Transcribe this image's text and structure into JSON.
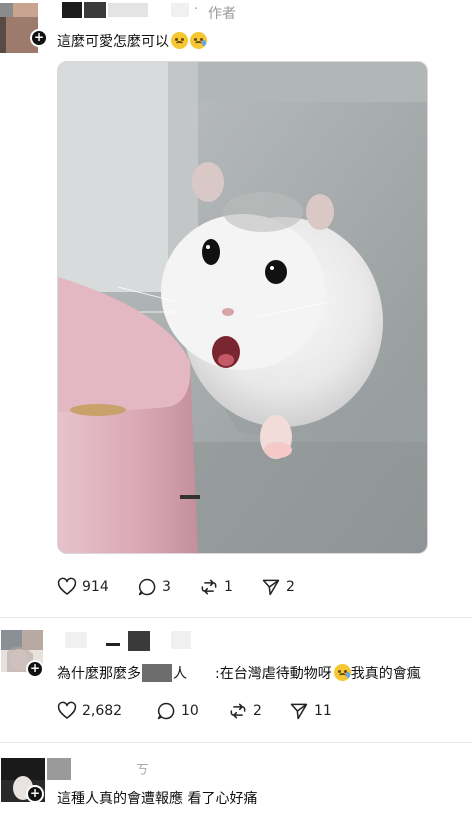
{
  "post": {
    "author_tag": "作者",
    "text": "這麼可愛怎麼可以",
    "emojis": [
      "sad-face-emoji",
      "crying-face-emoji"
    ],
    "actions": {
      "likes": "914",
      "replies": "3",
      "reposts": "1",
      "shares": "2"
    }
  },
  "reply1": {
    "text_before": "為什麼那麼多",
    "text_middle": "人",
    "text_after": ":在台灣虐待動物呀",
    "text_end": "我真的會瘋",
    "actions": {
      "likes": "2,682",
      "replies": "10",
      "reposts": "2",
      "shares": "11"
    }
  },
  "reply2": {
    "name_fragment": "ㄎ",
    "text": "這種人真的會遭報應 看了心好痛"
  },
  "icons": {
    "like": "heart-icon",
    "reply": "comment-bubble-icon",
    "repost": "repost-icon",
    "share": "send-icon",
    "follow": "plus-icon"
  },
  "colors": {
    "text": "#111111",
    "muted": "#9a9a9a",
    "divider": "#e6e6e6",
    "censor_dark": "#3a3a3a",
    "censor_light": "#e9e9e9"
  }
}
